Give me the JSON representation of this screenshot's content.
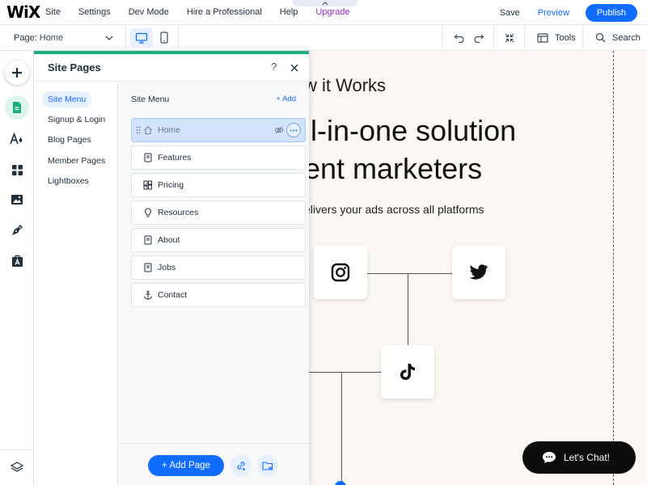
{
  "topbar": {
    "logo": "WiX",
    "menu": [
      {
        "label": "Site",
        "name": "menu-site"
      },
      {
        "label": "Settings",
        "name": "menu-settings"
      },
      {
        "label": "Dev Mode",
        "name": "menu-dev-mode"
      },
      {
        "label": "Hire a Professional",
        "name": "menu-hire-professional"
      },
      {
        "label": "Help",
        "name": "menu-help"
      },
      {
        "label": "Upgrade",
        "name": "menu-upgrade"
      }
    ],
    "save_label": "Save",
    "preview_label": "Preview",
    "publish_label": "Publish"
  },
  "secondbar": {
    "page_label": "Page:",
    "page_value": "Home",
    "tools_label": "Tools",
    "search_label": "Search"
  },
  "panel": {
    "title": "Site Pages",
    "help": "?",
    "nav": [
      "Site Menu",
      "Signup & Login",
      "Blog Pages",
      "Member Pages",
      "Lightboxes"
    ],
    "active_nav": "Site Menu",
    "list_header": "Site Menu",
    "add_label": "+ Add",
    "pages": [
      {
        "label": "Home",
        "icon": "home-icon"
      },
      {
        "label": "Features",
        "icon": "page-icon"
      },
      {
        "label": "Pricing",
        "icon": "pricing-plans-icon"
      },
      {
        "label": "Resources",
        "icon": "lightbulb-icon"
      },
      {
        "label": "About",
        "icon": "page-icon"
      },
      {
        "label": "Jobs",
        "icon": "page-icon"
      },
      {
        "label": "Contact",
        "icon": "anchor-icon"
      }
    ],
    "add_page_label": "+ Add Page"
  },
  "canvas": {
    "subheading": "w it Works",
    "title_line1": "ll-in-one solution",
    "title_line2": "ent marketers",
    "description": "elivers your ads across all platforms",
    "chat_label": "Let's Chat!"
  },
  "colors": {
    "accent": "#116dff",
    "upgrade": "#9a27d5",
    "panel_top": "#1dad7c",
    "canvas_bg": "#fbf8f3"
  }
}
